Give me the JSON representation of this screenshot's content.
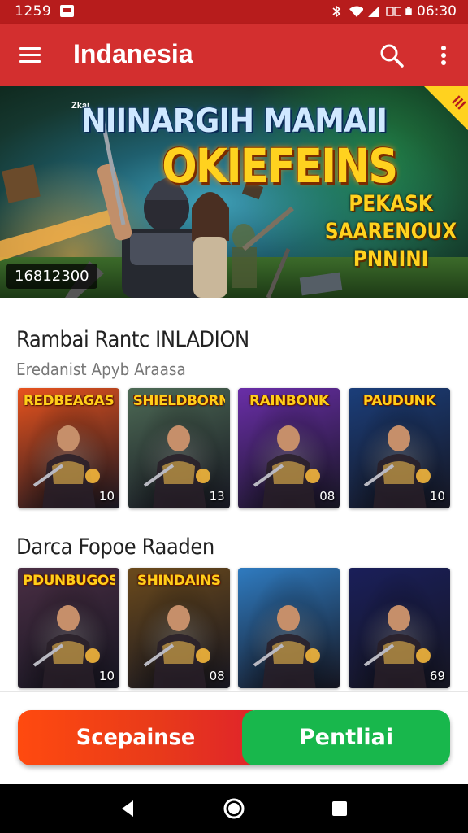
{
  "status_bar": {
    "time_left": "1259",
    "time_right": "06:30",
    "icons": [
      "notification-icon",
      "bluetooth-icon",
      "wifi-icon",
      "signal-icon",
      "data-icon",
      "battery-icon"
    ]
  },
  "app_bar": {
    "title": "Indanesia",
    "icons": [
      "menu-icon",
      "search-icon",
      "more-vert-icon"
    ]
  },
  "banner": {
    "small_label": "Zkai",
    "headline_1": "NIINARGIH MAMAII",
    "headline_2": "OKIEFEINS",
    "promo_lines": [
      "PEKASK",
      "SAARENOUX",
      "PNNINI"
    ],
    "corner_tag": "III",
    "counter": "16812300"
  },
  "section_1": {
    "title": "Rambai Rantc INLADION",
    "subtitle": "Eredanist Apyb Araasa",
    "cards": [
      {
        "logo": "REDBEAGAS",
        "badge": "10",
        "theme": "#e8531e"
      },
      {
        "logo": "SHIELDBORN",
        "badge": "13",
        "theme": "#4d6a55"
      },
      {
        "logo": "RAINBONK",
        "badge": "08",
        "theme": "#6a2ea8"
      },
      {
        "logo": "PAUDUNK",
        "badge": "10",
        "theme": "#1b3e7a"
      }
    ]
  },
  "section_2": {
    "title": "Darca Fopoe Raaden",
    "cards": [
      {
        "logo": "PDUNBUGOS",
        "badge": "10",
        "theme": "#4a2e44"
      },
      {
        "logo": "SHINDAINS",
        "badge": "08",
        "theme": "#6b4a1c"
      },
      {
        "logo": "",
        "badge": "",
        "theme": "#2f7bc0"
      },
      {
        "logo": "",
        "badge": "69",
        "theme": "#1a1f5a"
      }
    ]
  },
  "cta": {
    "left_label": "Scepainse",
    "right_label": "Pentliai",
    "left_color": "#ff4a0f",
    "right_color": "#18b74c"
  },
  "nav_bar": {
    "icons": [
      "back-icon",
      "home-icon",
      "recents-icon"
    ]
  }
}
